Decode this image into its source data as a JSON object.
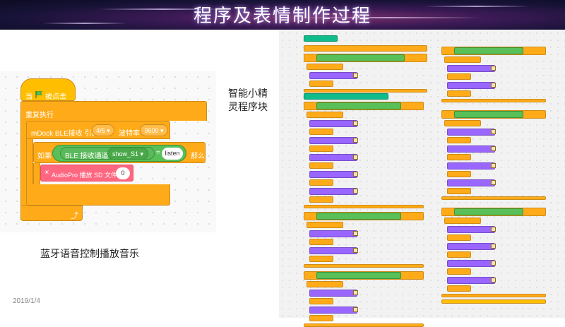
{
  "slide_title": "程序及表情制作过程",
  "date": "2019/1/4",
  "caption_left": "蓝牙语音控制播放音乐",
  "caption_right_line1": "智能小精",
  "caption_right_line2": "灵程序块",
  "blocks": {
    "hat_when": "当",
    "hat_clicked": "被点击",
    "forever": "重复执行",
    "ble_recv": "mDock BLE接收 引脚",
    "ble_pin": "4/5",
    "baud_label": "波特率",
    "baud_value": "9600",
    "if_label": "如果",
    "ble_channel_label": "BLE 接收通道",
    "ble_channel_value": "show_S1",
    "equals": "=",
    "compare_value": "listen",
    "then_label": "那么",
    "audio_label": "AudioPro 播放 SD 文件",
    "audio_value": "0"
  },
  "colors": {
    "control": "#ffab19",
    "event": "#ffbf00",
    "operator": "#59c059",
    "extension": "#ff6680",
    "looks": "#9966ff"
  }
}
